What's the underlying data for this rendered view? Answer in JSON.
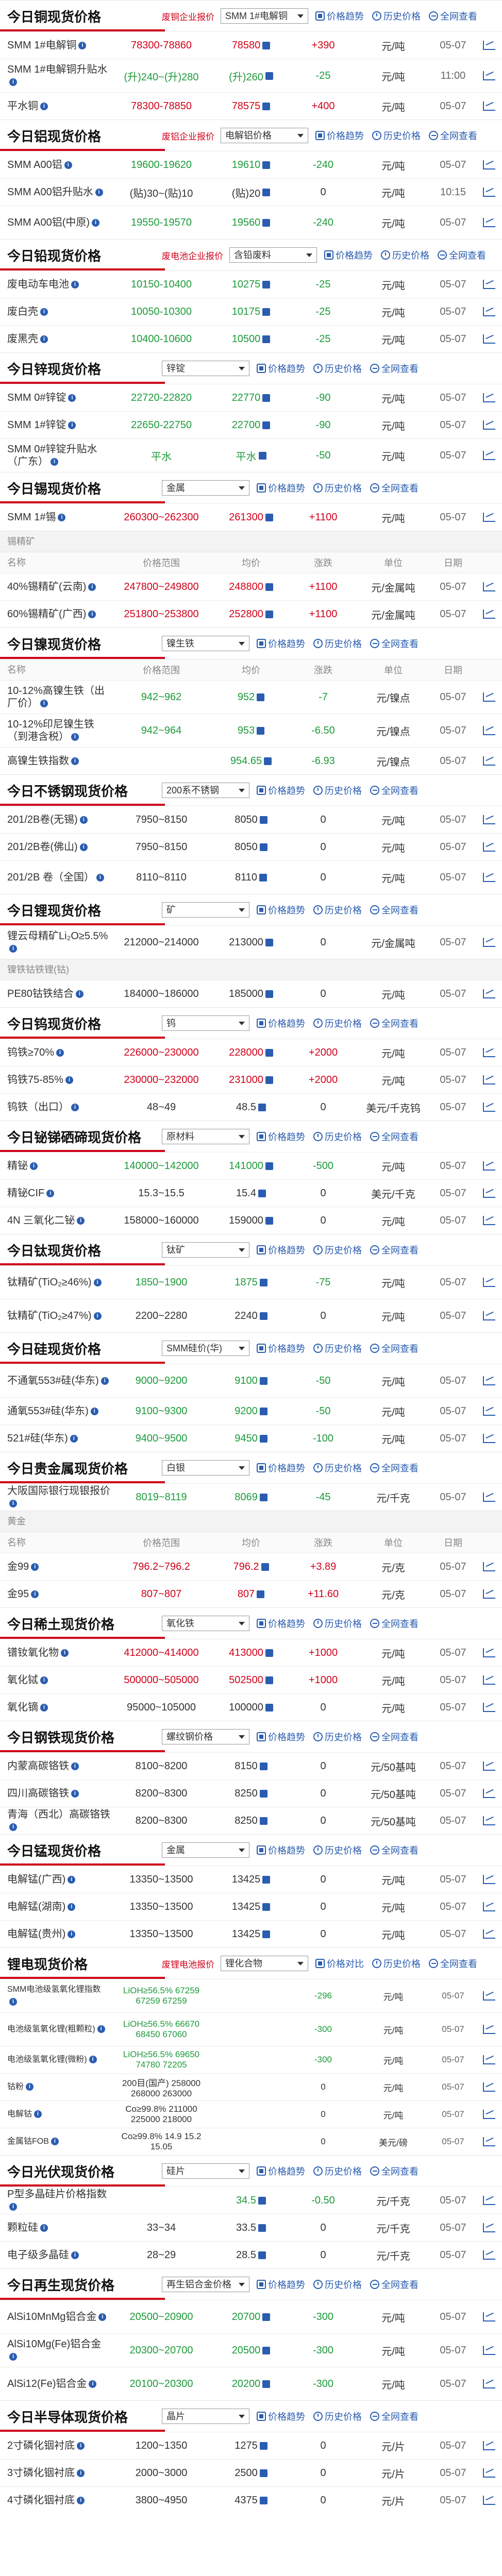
{
  "labels": {
    "price_trend": "价格趋势",
    "history": "历史价格",
    "view_all": "全网查看",
    "compare": "价格对比",
    "col_name": "名称",
    "col_range": "价格范围",
    "col_avg": "均价",
    "col_chg": "涨跌",
    "col_unit": "单位",
    "col_date": "日期"
  },
  "sections": [
    {
      "title": "今日铜现货价格",
      "tag": "废铜企业报价",
      "select": "SMM 1#电解铜",
      "rows": [
        {
          "name": "SMM 1#电解铜",
          "range": "78300-78860",
          "avg": "78580",
          "chg": "+390",
          "unit": "元/吨",
          "date": "05-07",
          "dir": "up"
        },
        {
          "name": "SMM 1#电解铜升贴水",
          "range": "(升)240~(升)280",
          "avg": "(升)260",
          "chg": "-25",
          "unit": "元/吨",
          "date": "11:00",
          "dir": "dn"
        },
        {
          "name": "平水铜",
          "range": "78300-78850",
          "avg": "78575",
          "chg": "+400",
          "unit": "元/吨",
          "date": "05-07",
          "dir": "up"
        }
      ]
    },
    {
      "title": "今日铝现货价格",
      "tag": "废铝企业报价",
      "select": "电解铝价格",
      "rows": [
        {
          "name": "SMM A00铝",
          "range": "19600-19620",
          "avg": "19610",
          "chg": "-240",
          "unit": "元/吨",
          "date": "05-07",
          "dir": "dn"
        },
        {
          "name": "SMM A00铝升贴水",
          "range": "(贴)30~(贴)10",
          "avg": "(贴)20",
          "chg": "0",
          "unit": "元/吨",
          "date": "10:15",
          "dir": "flat"
        },
        {
          "name": "SMM A00铝(中原)",
          "range": "19550-19570",
          "avg": "19560",
          "chg": "-240",
          "unit": "元/吨",
          "date": "05-07",
          "dir": "dn"
        }
      ]
    },
    {
      "title": "今日铅现货价格",
      "tag": "废电池企业报价",
      "select": "含铅废料",
      "rows": [
        {
          "name": "废电动车电池",
          "range": "10150-10400",
          "avg": "10275",
          "chg": "-25",
          "unit": "元/吨",
          "date": "05-07",
          "dir": "dn"
        },
        {
          "name": "废白壳",
          "range": "10050-10300",
          "avg": "10175",
          "chg": "-25",
          "unit": "元/吨",
          "date": "05-07",
          "dir": "dn"
        },
        {
          "name": "废黑壳",
          "range": "10400-10600",
          "avg": "10500",
          "chg": "-25",
          "unit": "元/吨",
          "date": "05-07",
          "dir": "dn"
        }
      ]
    },
    {
      "title": "今日锌现货价格",
      "tag": "",
      "select": "锌锭",
      "rows": [
        {
          "name": "SMM 0#锌锭",
          "range": "22720-22820",
          "avg": "22770",
          "chg": "-90",
          "unit": "元/吨",
          "date": "05-07",
          "dir": "dn"
        },
        {
          "name": "SMM 1#锌锭",
          "range": "22650-22750",
          "avg": "22700",
          "chg": "-90",
          "unit": "元/吨",
          "date": "05-07",
          "dir": "dn"
        },
        {
          "name": "SMM 0#锌锭升贴水（广东）",
          "range": "平水",
          "avg": "平水",
          "chg": "-50",
          "unit": "元/吨",
          "date": "05-07",
          "dir": "dn"
        }
      ]
    },
    {
      "title": "今日锡现货价格",
      "tag": "",
      "select": "金属",
      "rows": [
        {
          "name": "SMM 1#锡",
          "range": "260300~262300",
          "avg": "261300",
          "chg": "+1100",
          "unit": "元/吨",
          "date": "05-07",
          "dir": "up"
        }
      ],
      "subcat": "锡精矿",
      "cols": true,
      "rows2": [
        {
          "name": "40%锡精矿(云南)",
          "range": "247800~249800",
          "avg": "248800",
          "chg": "+1100",
          "unit": "元/金属吨",
          "date": "05-07",
          "dir": "up"
        },
        {
          "name": "60%锡精矿(广西)",
          "range": "251800~253800",
          "avg": "252800",
          "chg": "+1100",
          "unit": "元/金属吨",
          "date": "05-07",
          "dir": "up"
        }
      ]
    },
    {
      "title": "今日镍现货价格",
      "tag": "",
      "select": "镍生铁",
      "cols": true,
      "rows": [
        {
          "name": "10-12%高镍生铁（出厂价）",
          "range": "942~962",
          "avg": "952",
          "chg": "-7",
          "unit": "元/镍点",
          "date": "05-07",
          "dir": "dn"
        },
        {
          "name": "10-12%印尼镍生铁（到港含税）",
          "range": "942~964",
          "avg": "953",
          "chg": "-6.50",
          "unit": "元/镍点",
          "date": "05-07",
          "dir": "dn"
        },
        {
          "name": "高镍生铁指数",
          "range": "",
          "avg": "954.65",
          "chg": "-6.93",
          "unit": "元/镍点",
          "date": "05-07",
          "dir": "dn"
        }
      ]
    },
    {
      "title": "今日不锈钢现货价格",
      "tag": "",
      "select": "200系不锈钢",
      "rows": [
        {
          "name": "201/2B卷(无锡)",
          "range": "7950~8150",
          "avg": "8050",
          "chg": "0",
          "unit": "元/吨",
          "date": "05-07",
          "dir": "flat"
        },
        {
          "name": "201/2B卷(佛山)",
          "range": "7950~8150",
          "avg": "8050",
          "chg": "0",
          "unit": "元/吨",
          "date": "05-07",
          "dir": "flat"
        },
        {
          "name": "201/2B 卷（全国）",
          "range": "8110~8110",
          "avg": "8110",
          "chg": "0",
          "unit": "元/吨",
          "date": "05-07",
          "dir": "flat"
        }
      ]
    },
    {
      "title": "今日锂现货价格",
      "tag": "",
      "select": "矿",
      "rows": [
        {
          "name": "锂云母精矿Li₂O≥5.5%",
          "range": "212000~214000",
          "avg": "213000",
          "chg": "0",
          "unit": "元/金属吨",
          "date": "05-07",
          "dir": "flat"
        }
      ],
      "subcat": "镍铁钴铁锂(钴)",
      "rows2": [
        {
          "name": "PE80钴铁结合",
          "range": "184000~186000",
          "avg": "185000",
          "chg": "0",
          "unit": "元/吨",
          "date": "05-07",
          "dir": "flat"
        }
      ]
    },
    {
      "title": "今日钨现货价格",
      "tag": "",
      "select": "钨",
      "rows": [
        {
          "name": "钨铁≥70%",
          "range": "226000~230000",
          "avg": "228000",
          "chg": "+2000",
          "unit": "元/吨",
          "date": "05-07",
          "dir": "up"
        },
        {
          "name": "钨铁75-85%",
          "range": "230000~232000",
          "avg": "231000",
          "chg": "+2000",
          "unit": "元/吨",
          "date": "05-07",
          "dir": "up"
        },
        {
          "name": "钨铁（出口）",
          "range": "48~49",
          "avg": "48.5",
          "chg": "0",
          "unit": "美元/千克钨",
          "date": "05-07",
          "dir": "flat"
        }
      ]
    },
    {
      "title": "今日铋锑硒碲现货价格",
      "tag": "",
      "select": "原材料",
      "rows": [
        {
          "name": "精铋",
          "range": "140000~142000",
          "avg": "141000",
          "chg": "-500",
          "unit": "元/吨",
          "date": "05-07",
          "dir": "dn"
        },
        {
          "name": "精铋CIF",
          "range": "15.3~15.5",
          "avg": "15.4",
          "chg": "0",
          "unit": "美元/千克",
          "date": "05-07",
          "dir": "flat"
        },
        {
          "name": "4N 三氧化二铋",
          "range": "158000~160000",
          "avg": "159000",
          "chg": "0",
          "unit": "元/吨",
          "date": "05-07",
          "dir": "flat"
        }
      ]
    },
    {
      "title": "今日钛现货价格",
      "tag": "",
      "select": "钛矿",
      "rows": [
        {
          "name": "钛精矿(TiO₂≥46%)",
          "range": "1850~1900",
          "avg": "1875",
          "chg": "-75",
          "unit": "元/吨",
          "date": "05-07",
          "dir": "dn"
        },
        {
          "name": "钛精矿(TiO₂≥47%)",
          "range": "2200~2280",
          "avg": "2240",
          "chg": "0",
          "unit": "元/吨",
          "date": "05-07",
          "dir": "flat"
        }
      ]
    },
    {
      "title": "今日硅现货价格",
      "tag": "",
      "select": "SMM硅价(华)",
      "rows": [
        {
          "name": "不通氧553#硅(华东)",
          "range": "9000~9200",
          "avg": "9100",
          "chg": "-50",
          "unit": "元/吨",
          "date": "05-07",
          "dir": "dn"
        },
        {
          "name": "通氧553#硅(华东)",
          "range": "9100~9300",
          "avg": "9200",
          "chg": "-50",
          "unit": "元/吨",
          "date": "05-07",
          "dir": "dn"
        },
        {
          "name": "521#硅(华东)",
          "range": "9400~9500",
          "avg": "9450",
          "chg": "-100",
          "unit": "元/吨",
          "date": "05-07",
          "dir": "dn"
        }
      ]
    },
    {
      "title": "今日贵金属现货价格",
      "tag": "",
      "select": "白银",
      "rows": [
        {
          "name": "大阪国际银行现银报价",
          "range": "8019~8119",
          "avg": "8069",
          "chg": "-45",
          "unit": "元/千克",
          "date": "05-07",
          "dir": "dn"
        }
      ],
      "subcat": "黄金",
      "cols": true,
      "rows2": [
        {
          "name": "金99",
          "range": "796.2~796.2",
          "avg": "796.2",
          "chg": "+3.89",
          "unit": "元/克",
          "date": "05-07",
          "dir": "up"
        },
        {
          "name": "金95",
          "range": "807~807",
          "avg": "807",
          "chg": "+11.60",
          "unit": "元/克",
          "date": "05-07",
          "dir": "up"
        }
      ]
    },
    {
      "title": "今日稀土现货价格",
      "tag": "",
      "select": "氧化铁",
      "rows": [
        {
          "name": "镨钕氧化物",
          "range": "412000~414000",
          "avg": "413000",
          "chg": "+1000",
          "unit": "元/吨",
          "date": "05-07",
          "dir": "up"
        },
        {
          "name": "氧化铽",
          "range": "500000~505000",
          "avg": "502500",
          "chg": "+1000",
          "unit": "元/吨",
          "date": "05-07",
          "dir": "up"
        },
        {
          "name": "氧化镝",
          "range": "95000~105000",
          "avg": "100000",
          "chg": "0",
          "unit": "元/吨",
          "date": "05-07",
          "dir": "flat"
        }
      ]
    },
    {
      "title": "今日钢铁现货价格",
      "tag": "",
      "select": "螺纹钢价格",
      "rows": [
        {
          "name": "内蒙高碳铬铁",
          "range": "8100~8200",
          "avg": "8150",
          "chg": "0",
          "unit": "元/50基吨",
          "date": "05-07",
          "dir": "flat"
        },
        {
          "name": "四川高碳铬铁",
          "range": "8200~8300",
          "avg": "8250",
          "chg": "0",
          "unit": "元/50基吨",
          "date": "05-07",
          "dir": "flat"
        },
        {
          "name": "青海（西北）高碳铬铁",
          "range": "8200~8300",
          "avg": "8250",
          "chg": "0",
          "unit": "元/50基吨",
          "date": "05-07",
          "dir": "flat"
        }
      ]
    },
    {
      "title": "今日锰现货价格",
      "tag": "",
      "select": "金属",
      "rows": [
        {
          "name": "电解锰(广西)",
          "range": "13350~13500",
          "avg": "13425",
          "chg": "0",
          "unit": "元/吨",
          "date": "05-07",
          "dir": "flat"
        },
        {
          "name": "电解锰(湖南)",
          "range": "13350~13500",
          "avg": "13425",
          "chg": "0",
          "unit": "元/吨",
          "date": "05-07",
          "dir": "flat"
        },
        {
          "name": "电解锰(贵州)",
          "range": "13350~13500",
          "avg": "13425",
          "chg": "0",
          "unit": "元/吨",
          "date": "05-07",
          "dir": "flat"
        }
      ]
    },
    {
      "title": "锂电现货价格",
      "tag": "废锂电池报价",
      "select": "锂化合物",
      "tiny": true,
      "rows": [
        {
          "name": "SMM电池级氢氧化锂指数",
          "range": "LiOH≥56.5%  67259  67259  67259",
          "avg": "",
          "chg": "-296",
          "unit": "元/吨",
          "date": "05-07",
          "dir": "dn"
        },
        {
          "name": "电池级氢氧化锂(粗颗粒)",
          "range": "LiOH≥56.5%  66670  68450  67060",
          "avg": "",
          "chg": "-300",
          "unit": "元/吨",
          "date": "05-07",
          "dir": "dn"
        },
        {
          "name": "电池级氢氧化锂(微粉)",
          "range": "LiOH≥56.5%  69650  74780  72205",
          "avg": "",
          "chg": "-300",
          "unit": "元/吨",
          "date": "05-07",
          "dir": "dn"
        },
        {
          "name": "钴粉",
          "range": "200目(国产)  258000  268000  263000",
          "avg": "",
          "chg": "0",
          "unit": "元/吨",
          "date": "05-07",
          "dir": "flat"
        },
        {
          "name": "电解钴",
          "range": "Co≥99.8%  211000  225000  218000",
          "avg": "",
          "chg": "0",
          "unit": "元/吨",
          "date": "05-07",
          "dir": "flat"
        },
        {
          "name": "金属钴FOB",
          "range": "Co≥99.8%  14.9  15.2  15.05",
          "avg": "",
          "chg": "0",
          "unit": "美元/磅",
          "date": "05-07",
          "dir": "flat"
        }
      ]
    },
    {
      "title": "今日光伏现货价格",
      "tag": "",
      "select": "硅片",
      "rows": [
        {
          "name": "P型多晶硅片价格指数",
          "range": "",
          "avg": "34.5",
          "chg": "-0.50",
          "unit": "元/千克",
          "date": "05-07",
          "dir": "dn"
        },
        {
          "name": "颗粒硅",
          "range": "33~34",
          "avg": "33.5",
          "chg": "0",
          "unit": "元/千克",
          "date": "05-07",
          "dir": "flat"
        },
        {
          "name": "电子级多晶硅",
          "range": "28~29",
          "avg": "28.5",
          "chg": "0",
          "unit": "元/千克",
          "date": "05-07",
          "dir": "flat"
        }
      ]
    },
    {
      "title": "今日再生现货价格",
      "tag": "",
      "select": "再生铝合金价格",
      "rows": [
        {
          "name": "AlSi10MnMg铝合金",
          "range": "20500~20900",
          "avg": "20700",
          "chg": "-300",
          "unit": "元/吨",
          "date": "05-07",
          "dir": "dn"
        },
        {
          "name": "AlSi10Mg(Fe)铝合金",
          "range": "20300~20700",
          "avg": "20500",
          "chg": "-300",
          "unit": "元/吨",
          "date": "05-07",
          "dir": "dn"
        },
        {
          "name": "AlSi12(Fe)铝合金",
          "range": "20100~20300",
          "avg": "20200",
          "chg": "-300",
          "unit": "元/吨",
          "date": "05-07",
          "dir": "dn"
        }
      ]
    },
    {
      "title": "今日半导体现货价格",
      "tag": "",
      "select": "晶片",
      "rows": [
        {
          "name": "2寸磷化铟衬底",
          "range": "1200~1350",
          "avg": "1275",
          "chg": "0",
          "unit": "元/片",
          "date": "05-07",
          "dir": "flat"
        },
        {
          "name": "3寸磷化铟衬底",
          "range": "2000~3000",
          "avg": "2500",
          "chg": "0",
          "unit": "元/片",
          "date": "05-07",
          "dir": "flat"
        },
        {
          "name": "4寸磷化铟衬底",
          "range": "3800~4950",
          "avg": "4375",
          "chg": "0",
          "unit": "元/片",
          "date": "05-07",
          "dir": "flat"
        }
      ]
    }
  ],
  "colors": {
    "accent": "#d0021b",
    "link": "#2a5db0",
    "up": "#d0021b",
    "down": "#1d9a3a"
  }
}
